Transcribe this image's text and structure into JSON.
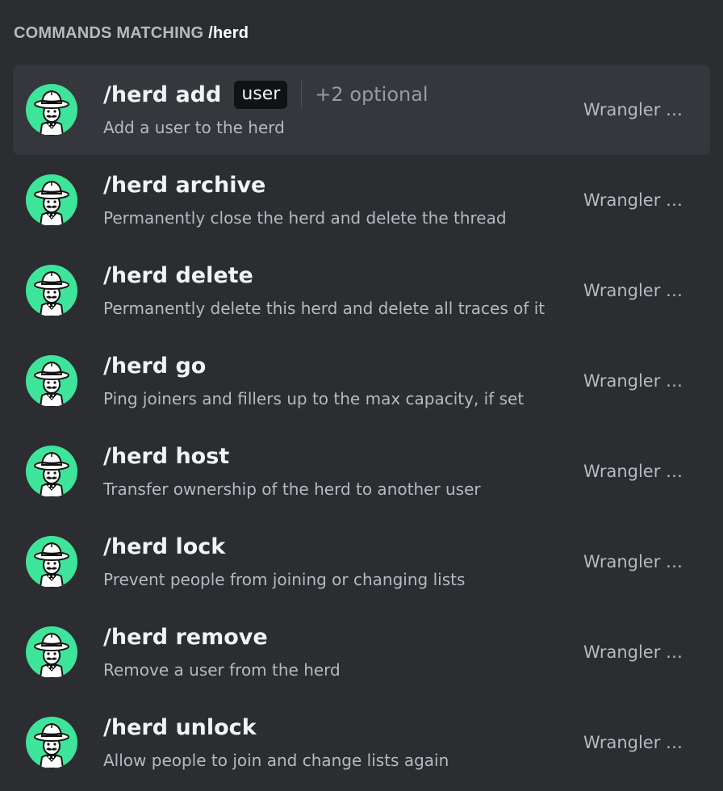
{
  "header": {
    "label": "COMMANDS MATCHING",
    "query": "/herd"
  },
  "colors": {
    "background": "#2b2d31",
    "selected_row": "#35373c",
    "avatar_bg": "#3ee49a",
    "badge_bg": "#111214"
  },
  "avatar_icon": "cowboy-bot-avatar",
  "commands": [
    {
      "name": "/herd add",
      "param": "user",
      "optional": "+2 optional",
      "description": "Add a user to the herd",
      "source": "Wrangler Alpha",
      "selected": true
    },
    {
      "name": "/herd archive",
      "description": "Permanently close the herd and delete the thread",
      "source": "Wrangler Alpha"
    },
    {
      "name": "/herd delete",
      "description": "Permanently delete this herd and delete all traces of it",
      "source": "Wrangler Alpha"
    },
    {
      "name": "/herd go",
      "description": "Ping joiners and fillers up to the max capacity, if set",
      "source": "Wrangler Alpha"
    },
    {
      "name": "/herd host",
      "description": "Transfer ownership of the herd to another user",
      "source": "Wrangler Alpha"
    },
    {
      "name": "/herd lock",
      "description": "Prevent people from joining or changing lists",
      "source": "Wrangler Alpha"
    },
    {
      "name": "/herd remove",
      "description": "Remove a user from the herd",
      "source": "Wrangler Alpha"
    },
    {
      "name": "/herd unlock",
      "description": "Allow people to join and change lists again",
      "source": "Wrangler Alpha"
    }
  ]
}
